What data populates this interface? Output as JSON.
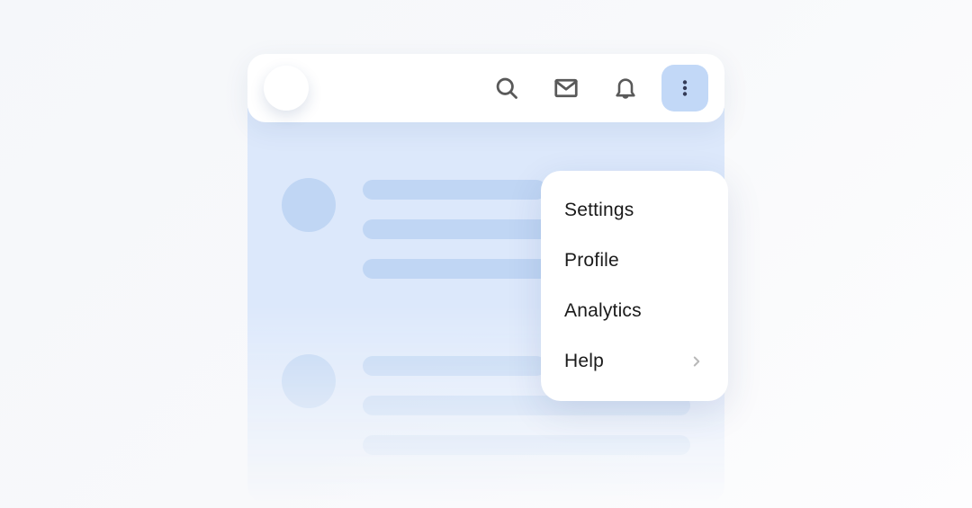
{
  "topbar": {
    "icons": {
      "search": "search-icon",
      "mail": "mail-icon",
      "bell": "bell-icon",
      "more": "more-vertical-icon"
    }
  },
  "dropdown": {
    "items": [
      {
        "label": "Settings",
        "hasSubmenu": false
      },
      {
        "label": "Profile",
        "hasSubmenu": false
      },
      {
        "label": "Analytics",
        "hasSubmenu": false
      },
      {
        "label": "Help",
        "hasSubmenu": true
      }
    ]
  },
  "colors": {
    "panelBg": "#dce8fb",
    "skeleton": "#c0d6f4",
    "moreBtnBg": "#c2d8f7",
    "iconStroke": "#595959",
    "dotFill": "#343b57"
  }
}
